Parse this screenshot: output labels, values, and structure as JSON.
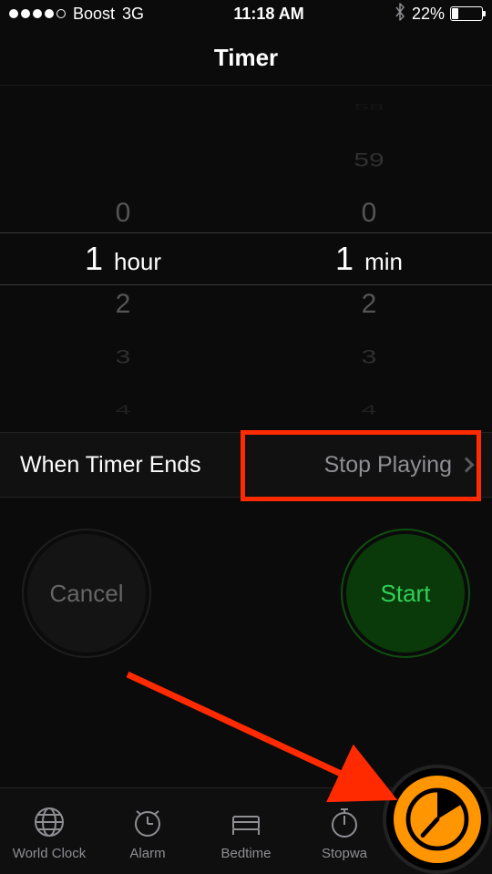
{
  "status": {
    "carrier": "Boost",
    "network": "3G",
    "time": "11:18 AM",
    "battery_pct_text": "22%",
    "battery_pct": 22,
    "signal_dots": 5,
    "signal_filled": 4,
    "bluetooth": true
  },
  "nav": {
    "title": "Timer"
  },
  "picker": {
    "hours": {
      "above": [
        "0"
      ],
      "selected": "1",
      "unit": "hour",
      "below": [
        "2",
        "3",
        "4"
      ]
    },
    "minutes": {
      "above": [
        "58",
        "59",
        "0"
      ],
      "selected": "1",
      "unit": "min",
      "below": [
        "2",
        "3",
        "4"
      ]
    }
  },
  "when_ends": {
    "label": "When Timer Ends",
    "value": "Stop Playing"
  },
  "buttons": {
    "cancel": "Cancel",
    "start": "Start"
  },
  "tabs": [
    {
      "id": "worldclock",
      "label": "World Clock"
    },
    {
      "id": "alarm",
      "label": "Alarm"
    },
    {
      "id": "bedtime",
      "label": "Bedtime"
    },
    {
      "id": "stopwatch",
      "label": "Stopwa"
    },
    {
      "id": "timer",
      "label": "Timer"
    }
  ],
  "annotations": {
    "highlight_box": true,
    "arrow": true,
    "color": "#ff2a00"
  }
}
